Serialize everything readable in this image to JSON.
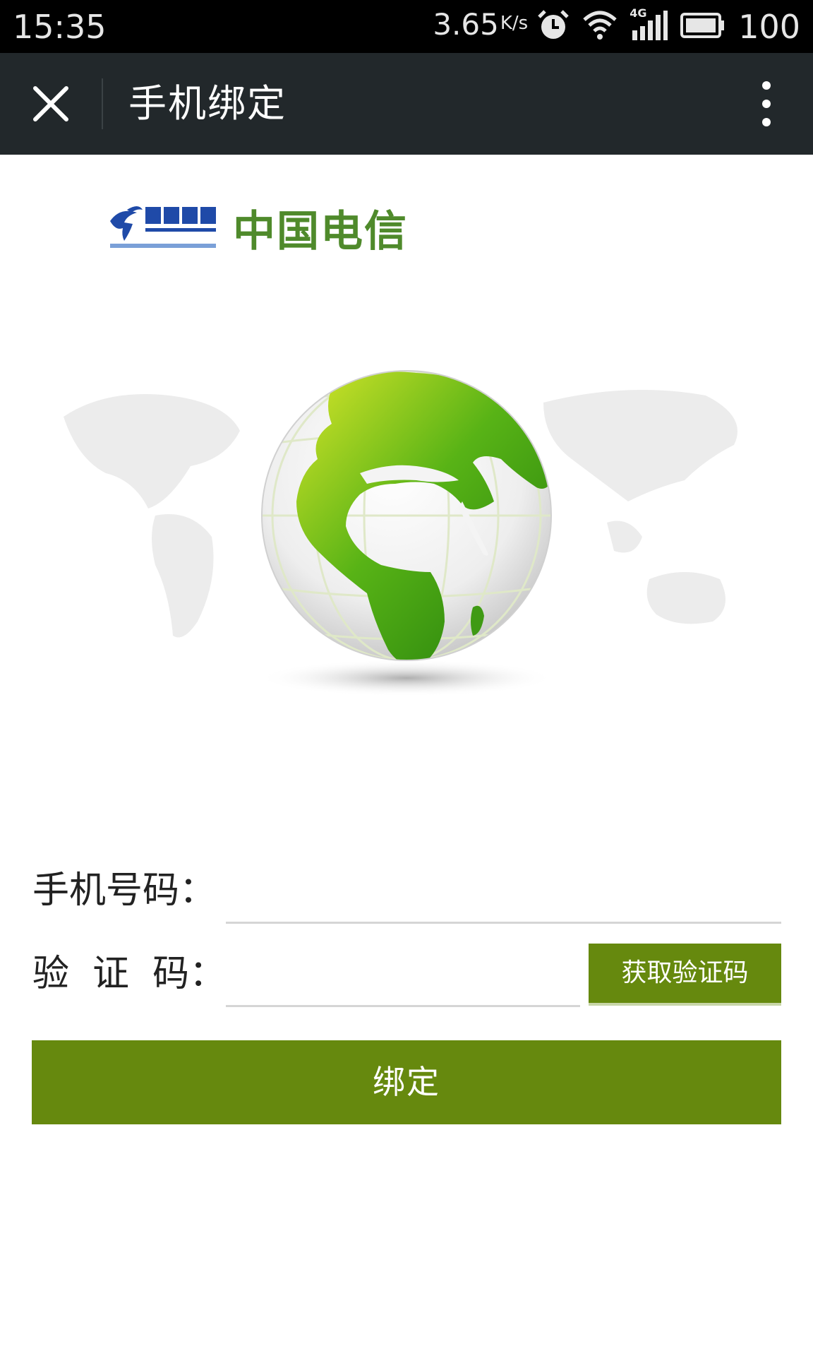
{
  "status_bar": {
    "time": "15:35",
    "speed": "3.65",
    "speed_unit": "K/s",
    "network_label": "4G",
    "battery": "100",
    "icons": [
      "alarm-icon",
      "wifi-icon",
      "signal-icon",
      "battery-icon"
    ]
  },
  "title_bar": {
    "title": "手机绑定",
    "close_icon": "close-icon",
    "more_icon": "more-vertical-icon"
  },
  "logo": {
    "brand_text": "中国电信",
    "brand_color": "#4f8a2b",
    "icon": "china-telecom-logo-icon"
  },
  "hero": {
    "image": "green-globe-world-map"
  },
  "form": {
    "phone_label": "手机号码：",
    "phone_value": "",
    "code_label": "验  证  码：",
    "code_value": "",
    "get_code_button": "获取验证码",
    "submit_button": "绑定",
    "accent_color": "#66890e"
  }
}
